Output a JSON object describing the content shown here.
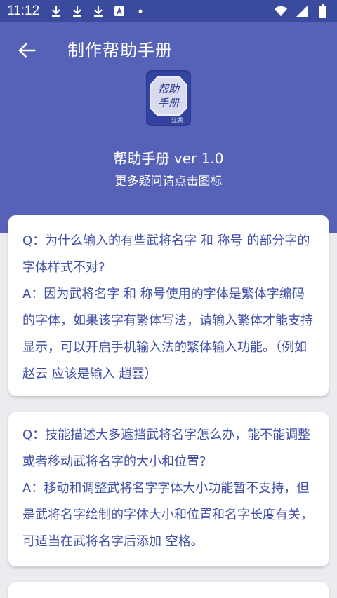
{
  "status_bar": {
    "time": "11:12",
    "left_icons": [
      "download-icon",
      "download-icon",
      "download-icon",
      "a-square-icon",
      "dot-icon"
    ],
    "right_icons": [
      "wifi-icon",
      "signal-icon",
      "battery-icon"
    ]
  },
  "header": {
    "title": "制作帮助手册",
    "app_icon_text": [
      "帮助",
      "手册"
    ],
    "app_icon_signature": "江湖",
    "version": "帮助手册 ver 1.0",
    "hint": "更多疑问请点击图标",
    "colors": {
      "status_bar": "#3a4a9c",
      "header": "#5562b8",
      "text": "#4050a6"
    }
  },
  "faq": [
    {
      "question": "Q：为什么输入的有些武将名字 和 称号 的部分字的字体样式不对?",
      "answer": "A：因为武将名字 和 称号使用的字体是繁体字编码的字体，如果该字有繁体写法，请输入繁体才能支持显示，可以开启手机输入法的繁体输入功能。（例如 赵云 应该是输入 趙雲）"
    },
    {
      "question": "Q：技能描述大多遮挡武将名字怎么办，能不能调整或者移动武将名字的大小和位置?",
      "answer": "A：移动和调整武将名字字体大小功能暂不支持，但是武将名字绘制的字体大小和位置和名字长度有关，可适当在武将名字后添加 空格。"
    }
  ]
}
